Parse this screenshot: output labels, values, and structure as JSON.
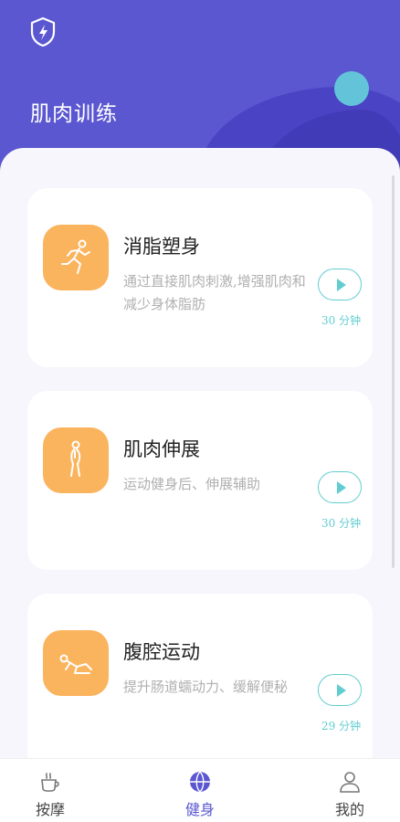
{
  "header": {
    "title": "肌肉训练"
  },
  "cards": [
    {
      "title": "消脂塑身",
      "desc": "通过直接肌肉刺激,增强肌肉和减少身体脂肪",
      "time": "30 分钟",
      "icon": "running-figure-icon"
    },
    {
      "title": "肌肉伸展",
      "desc": "运动健身后、伸展辅助",
      "time": "30 分钟",
      "icon": "stretching-figure-icon"
    },
    {
      "title": "腹腔运动",
      "desc": "提升肠道蠕动力、缓解便秘",
      "time": "29 分钟",
      "icon": "lying-figure-icon"
    }
  ],
  "tabs": [
    {
      "label": "按摩",
      "icon": "coffee-cup-icon",
      "active": false
    },
    {
      "label": "健身",
      "icon": "basketball-icon",
      "active": true
    },
    {
      "label": "我的",
      "icon": "user-icon",
      "active": false
    }
  ],
  "colors": {
    "primary": "#5b57d1",
    "accent": "#62cdd1",
    "icon_bg": "#fbb45e"
  }
}
